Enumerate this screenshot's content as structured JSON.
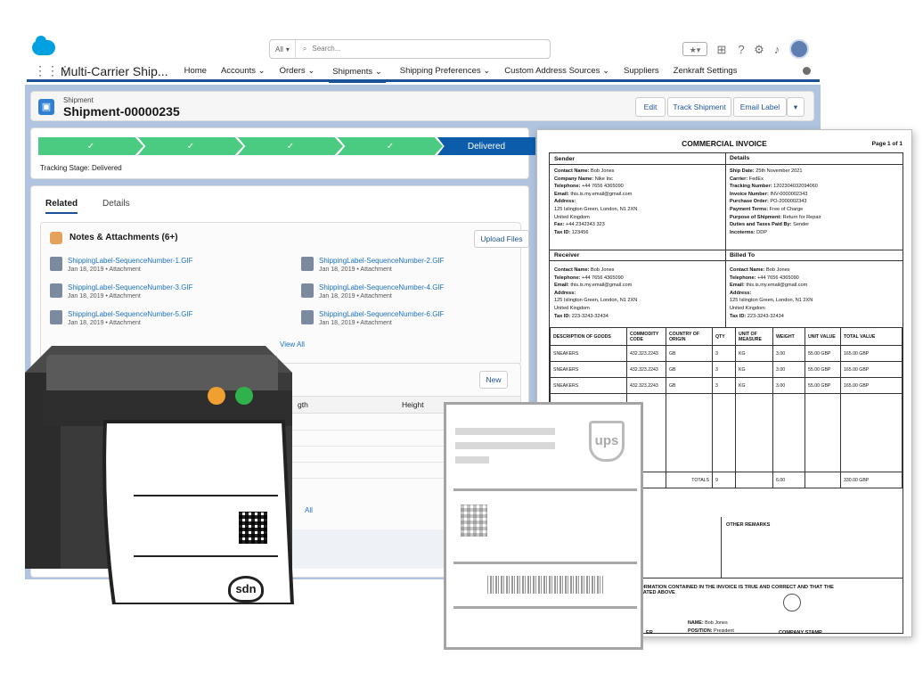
{
  "top": {
    "search_scope": "All",
    "search_placeholder": "Search..."
  },
  "nav": {
    "app_name": "Multi-Carrier Ship...",
    "items": [
      {
        "label": "Home",
        "chev": ""
      },
      {
        "label": "Accounts",
        "chev": "⌄"
      },
      {
        "label": "Orders",
        "chev": "⌄"
      },
      {
        "label": "Shipments",
        "chev": "⌄"
      },
      {
        "label": "Shipping Preferences",
        "chev": "⌄"
      },
      {
        "label": "Custom Address Sources",
        "chev": "⌄"
      },
      {
        "label": "Suppliers",
        "chev": ""
      },
      {
        "label": "Zenkraft Settings",
        "chev": ""
      }
    ]
  },
  "record": {
    "object": "Shipment",
    "name": "Shipment-00000235",
    "edit": "Edit",
    "track": "Track Shipment",
    "email": "Email Label"
  },
  "path": {
    "stage_check": "✓",
    "current": "Delivered",
    "tracking_label": "Tracking Stage: Delivered"
  },
  "tabs": {
    "related": "Related",
    "details": "Details"
  },
  "notes": {
    "title": "Notes & Attachments (6+)",
    "upload": "Upload Files",
    "view_all": "View All",
    "items": [
      {
        "name": "ShippingLabel-SequenceNumber-1.GIF",
        "meta": "Jan 18, 2019 • Attachment"
      },
      {
        "name": "ShippingLabel-SequenceNumber-2.GIF",
        "meta": "Jan 18, 2019 • Attachment"
      },
      {
        "name": "ShippingLabel-SequenceNumber-3.GIF",
        "meta": "Jan 18, 2019 • Attachment"
      },
      {
        "name": "ShippingLabel-SequenceNumber-4.GIF",
        "meta": "Jan 18, 2019 • Attachment"
      },
      {
        "name": "ShippingLabel-SequenceNumber-5.GIF",
        "meta": "Jan 18, 2019 • Attachment"
      },
      {
        "name": "ShippingLabel-SequenceNumber-6.GIF",
        "meta": "Jan 18, 2019 • Attachment"
      }
    ]
  },
  "dims": {
    "new": "New",
    "col_length_partial": "gth",
    "col_height": "Height",
    "view_all_partial": "All"
  },
  "invoice": {
    "title": "COMMERCIAL INVOICE",
    "page": "Page 1 of 1",
    "sender_h": "Sender",
    "details_h": "Details",
    "receiver_h": "Receiver",
    "billed_h": "Billed To",
    "sender": [
      {
        "k": "Contact Name:",
        "v": " Bob Jones"
      },
      {
        "k": "Company Name:",
        "v": " Nike Inc"
      },
      {
        "k": "Telephone:",
        "v": " +44 7656 4365090"
      },
      {
        "k": "Email:",
        "v": " this.is.my.email@gmail.com"
      },
      {
        "k": "Address:",
        "v": ""
      },
      {
        "k": "",
        "v": "125 Islington Green, London, N1 2XN"
      },
      {
        "k": "",
        "v": "United Kingdom"
      },
      {
        "k": "Fax:",
        "v": " +44 2342343 323"
      },
      {
        "k": "Tax ID:",
        "v": " 123456"
      }
    ],
    "details": [
      {
        "k": "Ship Date:",
        "v": " 25th November 2021"
      },
      {
        "k": "Carrier:",
        "v": " FedEx"
      },
      {
        "k": "Tracking Number:",
        "v": " 1202304032094060"
      },
      {
        "k": "Invoice Number:",
        "v": " INV-0000002343"
      },
      {
        "k": "Purchase Order:",
        "v": " PO-2000002343"
      },
      {
        "k": "Payment Terms:",
        "v": " Free of Charge"
      },
      {
        "k": "Purpose of Shipment:",
        "v": " Return for Repair"
      },
      {
        "k": "Duties and Taxes Paid By:",
        "v": " Sender"
      },
      {
        "k": "Incoterms:",
        "v": " DDP"
      }
    ],
    "receiver": [
      {
        "k": "Contact Name:",
        "v": " Bob Jones"
      },
      {
        "k": "Telephone:",
        "v": " +44 7656 4365090"
      },
      {
        "k": "Email:",
        "v": " this.is.my.email@gmail.com"
      },
      {
        "k": "Address:",
        "v": ""
      },
      {
        "k": "",
        "v": "125 Islington Green, London, N1 2XN"
      },
      {
        "k": "",
        "v": "United Kingdom"
      },
      {
        "k": "Tax ID:",
        "v": " 223-3243-32434"
      }
    ],
    "billed": [
      {
        "k": "Contact Name:",
        "v": " Bob Jones"
      },
      {
        "k": "Telephone:",
        "v": " +44 7656 4365090"
      },
      {
        "k": "Email:",
        "v": " this.is.my.email@gmail.com"
      },
      {
        "k": "Address:",
        "v": ""
      },
      {
        "k": "",
        "v": "125 Islington Green, London, N1 2XN"
      },
      {
        "k": "",
        "v": "United Kingdom"
      },
      {
        "k": "Tax ID:",
        "v": " 223-3243-32434"
      }
    ],
    "cols": [
      "DESCRIPTION OF GOODS",
      "COMMODITY CODE",
      "COUNTRY OF ORIGIN",
      "QTY",
      "UNIT OF MEASURE",
      "WEIGHT",
      "UNIT VALUE",
      "TOTAL VALUE"
    ],
    "rows": [
      [
        "SNEAKERS",
        "432.323.2243",
        "GB",
        "3",
        "KG",
        "3.00",
        "55.00 GBP",
        "165.00 GBP"
      ],
      [
        "SNEAKERS",
        "432.323.2243",
        "GB",
        "3",
        "KG",
        "3.00",
        "55.00 GBP",
        "165.00 GBP"
      ],
      [
        "SNEAKERS",
        "432.323.2243",
        "GB",
        "3",
        "KG",
        "3.00",
        "55.00 GBP",
        "165.00 GBP"
      ]
    ],
    "totals_label": "TOTALS",
    "totals_qty": "9",
    "totals_weight": "6.00",
    "totals_value": "330.00 GBP",
    "other_remarks": "OTHER REMARKS",
    "declaration_1": "FORMATION CONTAINED IN THE INVOICE IS TRUE AND CORRECT AND THAT THE",
    "declaration_2": "STATED ABOVE",
    "name_k": "NAME:",
    "name_v": " Bob Jones",
    "position_k": "POSITION:",
    "position_v": " President",
    "signer_partial": "ER",
    "stamp": "COMPANY STAMP"
  },
  "label_logo": "ups",
  "printer_logo": "sdn"
}
